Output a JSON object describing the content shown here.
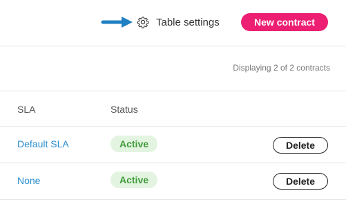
{
  "toolbar": {
    "table_settings_label": "Table settings",
    "new_contract_label": "New contract",
    "accent_color": "#ec1f73",
    "settings_icon": "gear-icon",
    "pointer_icon": "arrow-right-icon"
  },
  "info": {
    "displaying_text": "Displaying 2 of 2 contracts"
  },
  "table": {
    "headers": {
      "sla": "SLA",
      "status": "Status"
    },
    "rows": [
      {
        "sla": "Default SLA",
        "status": "Active",
        "action": "Delete"
      },
      {
        "sla": "None",
        "status": "Active",
        "action": "Delete"
      }
    ]
  },
  "colors": {
    "link": "#2a8ccf",
    "status_active_bg": "#e3f4e1",
    "status_active_text": "#3f9b3a"
  }
}
